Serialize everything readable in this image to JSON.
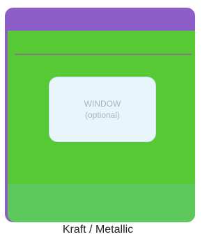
{
  "window": {
    "title": "WINDOW",
    "subtitle": "(optional)"
  },
  "caption": "Kraft / Metallic",
  "colors": {
    "back_panel": "#8d5ec8",
    "front_panel": "#57c934",
    "bottom_gusset": "#5dc95d",
    "window_fill": "#e8f6fc",
    "fold_line": "#7f7f7f"
  }
}
